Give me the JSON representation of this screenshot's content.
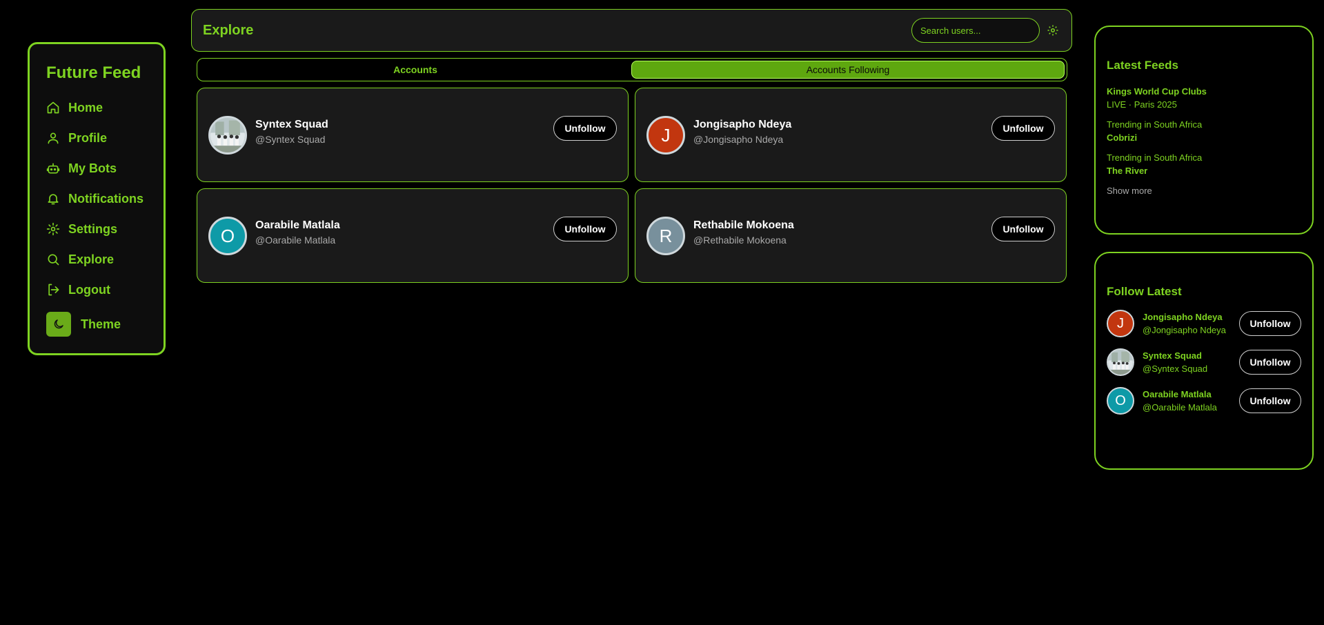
{
  "sidebar": {
    "brand": "Future Feed",
    "items": [
      {
        "label": "Home",
        "icon": "home-icon"
      },
      {
        "label": "Profile",
        "icon": "user-icon"
      },
      {
        "label": "My Bots",
        "icon": "bot-icon"
      },
      {
        "label": "Notifications",
        "icon": "bell-icon"
      },
      {
        "label": "Settings",
        "icon": "gear-icon"
      },
      {
        "label": "Explore",
        "icon": "search-icon"
      },
      {
        "label": "Logout",
        "icon": "logout-icon"
      },
      {
        "label": "Theme",
        "icon": "moon-icon"
      }
    ]
  },
  "header": {
    "title": "Explore",
    "search_placeholder": "Search users..."
  },
  "tabs": [
    {
      "label": "Accounts",
      "active": false
    },
    {
      "label": "Accounts Following",
      "active": true
    }
  ],
  "accounts": [
    {
      "name": "Syntex Squad",
      "handle": "@Syntex Squad",
      "initial": "",
      "avatar_color": "#8a9a8a",
      "button": "Unfollow"
    },
    {
      "name": "Jongisapho Ndeya",
      "handle": "@Jongisapho Ndeya",
      "initial": "J",
      "avatar_color": "#c2360f",
      "button": "Unfollow"
    },
    {
      "name": "Oarabile Matlala",
      "handle": "@Oarabile Matlala",
      "initial": "O",
      "avatar_color": "#0e9aa7",
      "button": "Unfollow"
    },
    {
      "name": "Rethabile Mokoena",
      "handle": "@Rethabile Mokoena",
      "initial": "R",
      "avatar_color": "#78909c",
      "button": "Unfollow"
    }
  ],
  "latest_feeds": {
    "title": "Latest Feeds",
    "items": [
      {
        "top": "Kings World Cup Clubs",
        "bottom": "LIVE · Paris 2025"
      },
      {
        "top": "Trending in South Africa",
        "bottom": "Cobrizi"
      },
      {
        "top": "Trending in South Africa",
        "bottom": "The River"
      }
    ],
    "show_more": "Show more"
  },
  "follow_latest": {
    "title": "Follow Latest",
    "items": [
      {
        "name": "Jongisapho Ndeya",
        "handle": "@Jongisapho Ndeya",
        "initial": "J",
        "avatar_color": "#c2360f",
        "button": "Unfollow"
      },
      {
        "name": "Syntex Squad",
        "handle": "@Syntex Squad",
        "initial": "",
        "avatar_color": "#8a9a8a",
        "button": "Unfollow"
      },
      {
        "name": "Oarabile Matlala",
        "handle": "@Oarabile Matlala",
        "initial": "O",
        "avatar_color": "#0e9aa7",
        "button": "Unfollow"
      }
    ]
  },
  "colors": {
    "accent": "#7ed321",
    "tab_active_bg": "#5ea70f",
    "card_bg": "#1a1a1a",
    "page_bg": "#000000"
  }
}
